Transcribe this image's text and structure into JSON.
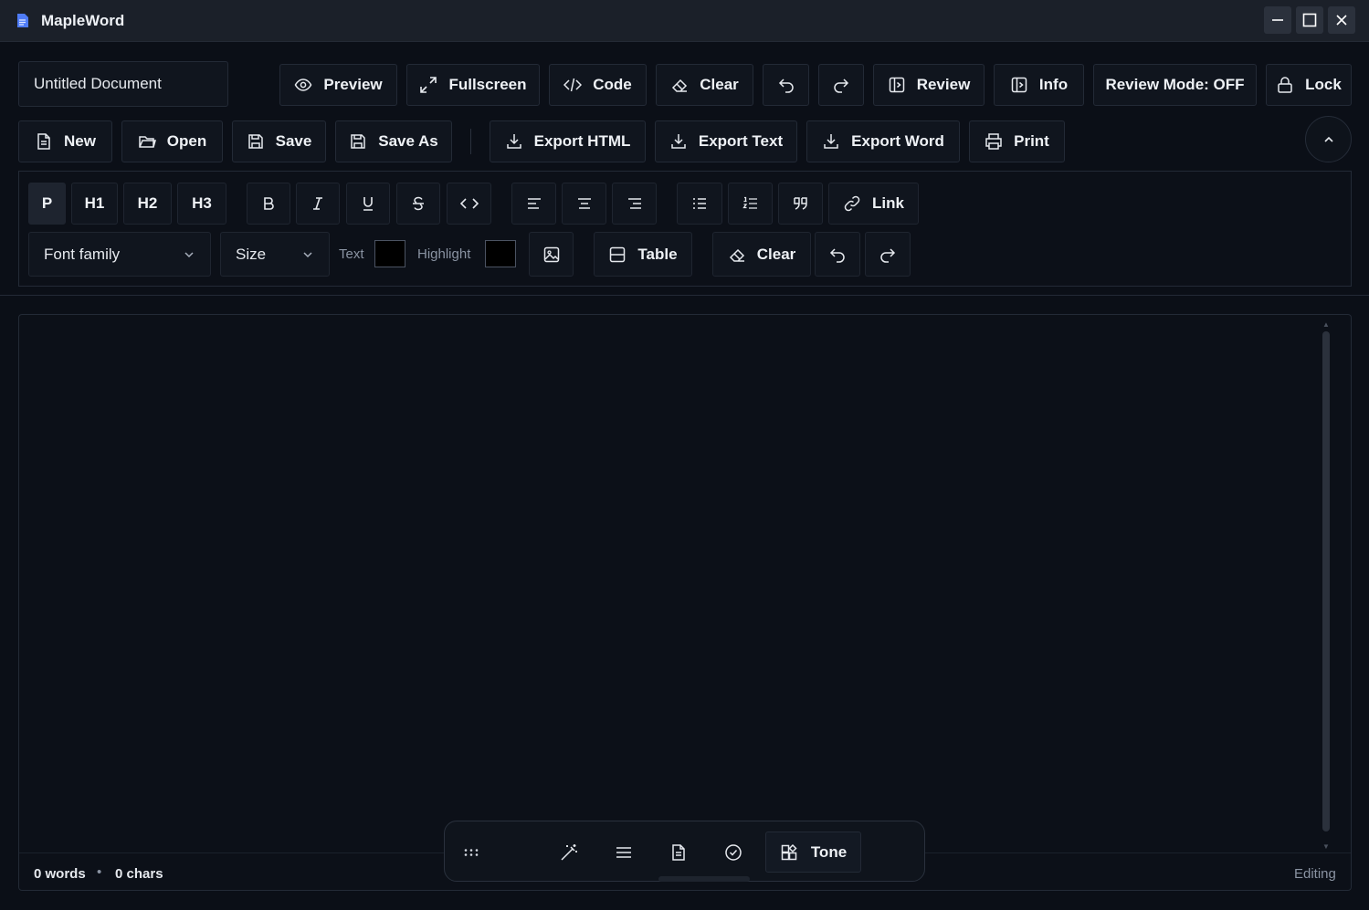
{
  "app": {
    "title": "MapleWord"
  },
  "document": {
    "title": "Untitled Document"
  },
  "toolbar_top": {
    "preview": "Preview",
    "fullscreen": "Fullscreen",
    "code": "Code",
    "clear": "Clear",
    "review": "Review",
    "info": "Info",
    "review_mode": "Review Mode: OFF",
    "lock": "Lock"
  },
  "toolbar_file": {
    "new": "New",
    "open": "Open",
    "save": "Save",
    "save_as": "Save As",
    "export_html": "Export HTML",
    "export_text": "Export Text",
    "export_word": "Export Word",
    "print": "Print"
  },
  "format": {
    "paragraph": "P",
    "h1": "H1",
    "h2": "H2",
    "h3": "H3",
    "link": "Link",
    "font_family": "Font family",
    "size": "Size",
    "text_label": "Text",
    "highlight_label": "Highlight",
    "text_color": "#000000",
    "highlight_color": "#000000",
    "table": "Table",
    "clear": "Clear"
  },
  "status": {
    "words": "0 words",
    "separator": "•",
    "chars": "0 chars",
    "mode": "Editing"
  },
  "floating_bar": {
    "tone": "Tone"
  },
  "colors": {
    "background": "#0b0f17",
    "titlebar": "#1b2029",
    "button": "#10151e",
    "border": "#232a36",
    "accent_logo": "#4f7cf7"
  }
}
